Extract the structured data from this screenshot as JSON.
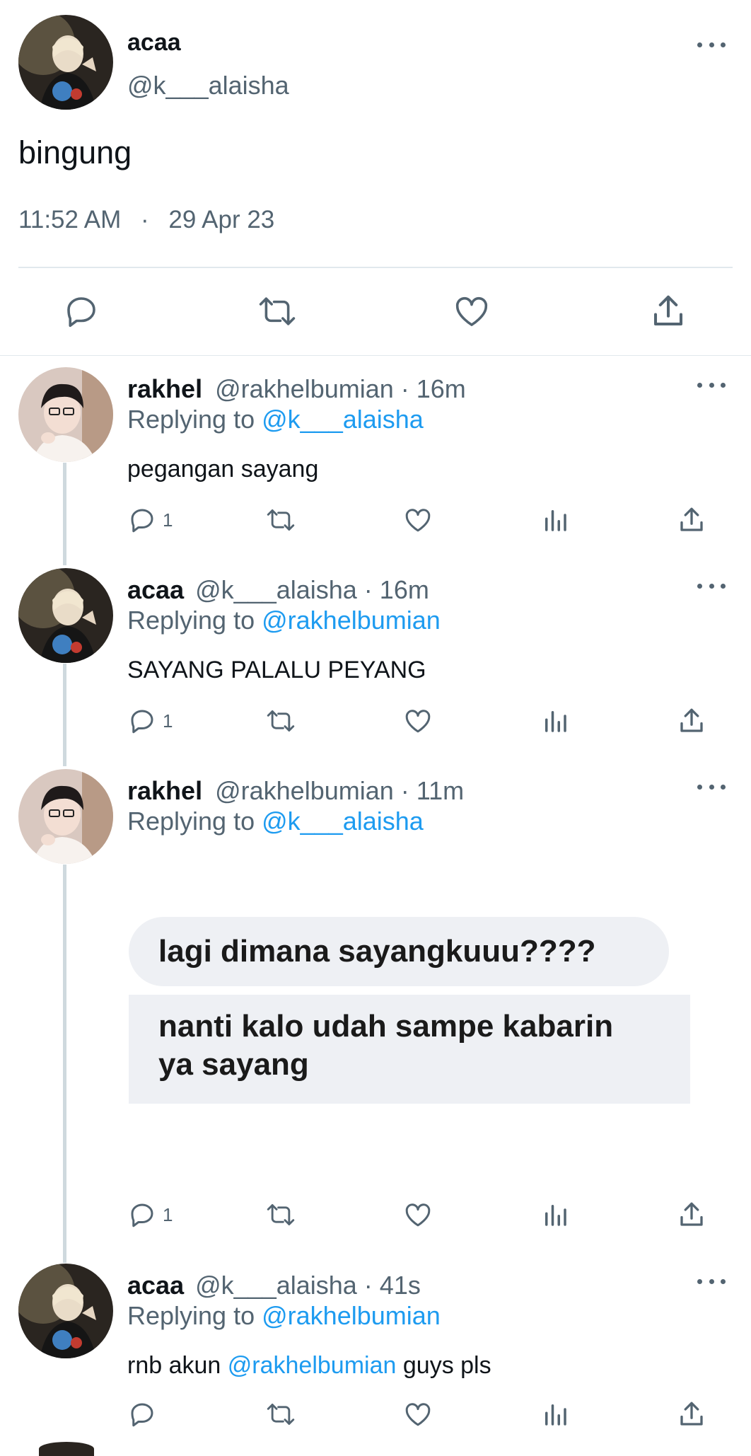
{
  "main_tweet": {
    "name": "acaa",
    "handle": "@k___alaisha",
    "text": "bingung",
    "time": "11:52 AM",
    "separator": "·",
    "date": "29 Apr 23"
  },
  "replies": [
    {
      "name": "rakhel",
      "meta": "@rakhelbumian · 16m",
      "replying_label": "Replying to",
      "replying_to": "@k___alaisha",
      "text": "pegangan sayang",
      "reply_count": "1"
    },
    {
      "name": "acaa",
      "meta": "@k___alaisha · 16m",
      "replying_label": "Replying to",
      "replying_to": "@rakhelbumian",
      "text": "SAYANG PALALU PEYANG",
      "reply_count": "1"
    },
    {
      "name": "rakhel",
      "meta": "@rakhelbumian · 11m",
      "replying_label": "Replying to",
      "replying_to": "@k___alaisha",
      "image_lines": [
        "lagi dimana sayangkuuu????",
        "nanti kalo udah sampe kabarin",
        "ya sayang"
      ],
      "reply_count": "1"
    },
    {
      "name": "acaa",
      "meta": "@k___alaisha · 41s",
      "replying_label": "Replying to",
      "replying_to": "@rakhelbumian",
      "text_before": "rnb akun",
      "text_mention": "@rakhelbumian",
      "text_after": "guys pls"
    }
  ],
  "icons": [
    "more-icon",
    "reply-icon",
    "retweet-icon",
    "like-icon",
    "views-icon",
    "share-icon"
  ],
  "colors": {
    "accent": "#1d9bf0",
    "secondary_text": "#536471",
    "divider": "#cfd9de"
  }
}
